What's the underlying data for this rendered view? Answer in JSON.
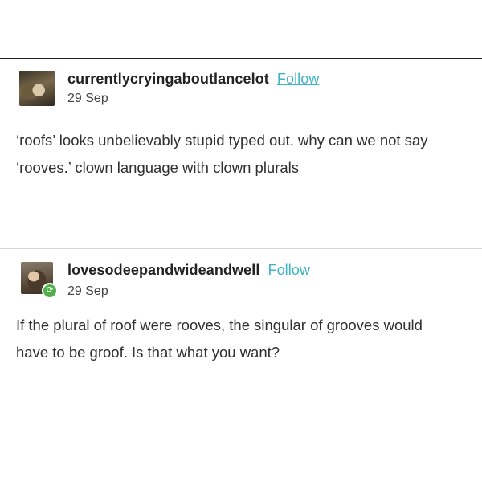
{
  "posts": [
    {
      "username": "currentlycryingaboutlancelot",
      "follow_label": "Follow",
      "date": "29 Sep",
      "avatar_icon": "user-avatar",
      "text": "‘roofs’ looks unbelievably stupid typed out. why can we not say ‘rooves.’ clown language with clown plurals"
    },
    {
      "username": "lovesodeepandwideandwell",
      "follow_label": "Follow",
      "date": "29 Sep",
      "avatar_icon": "user-avatar",
      "badge_icon": "reblog-icon",
      "text": "If the plural of roof were rooves, the singular of grooves would have to be groof. Is that what you want?"
    }
  ],
  "colors": {
    "follow_link": "#3fb3c8",
    "reblog_badge": "#4fb04a",
    "text": "#2f2f2f"
  }
}
